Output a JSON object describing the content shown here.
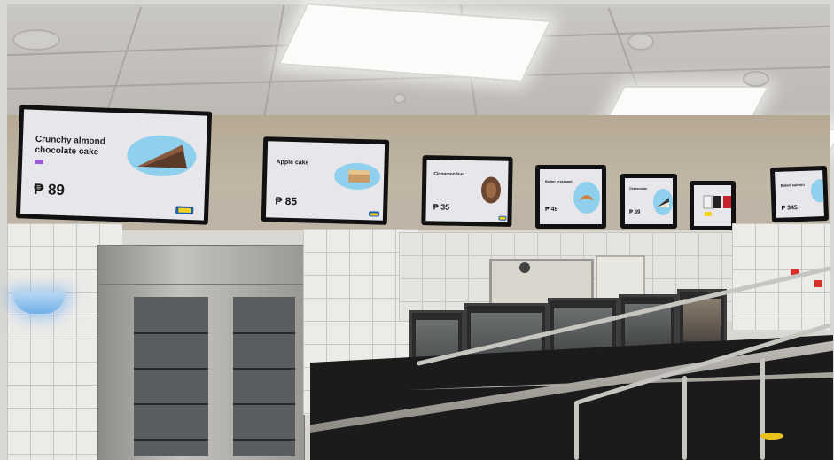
{
  "menu_screens": [
    {
      "title": "Crunchy almond chocolate cake",
      "price": "₱ 89",
      "food": "chocolate-cake-slice"
    },
    {
      "title": "Apple cake",
      "price": "₱ 85",
      "food": "apple-cake-slice"
    },
    {
      "title": "Cinnamon bun",
      "price": "₱ 35",
      "food": "cinnamon-bun"
    },
    {
      "title": "Butter croissant",
      "price": "₱ 49",
      "food": "croissant"
    },
    {
      "title": "Cheesecake",
      "price": "₱ 89",
      "food": "cheesecake-slice"
    },
    {
      "title": "",
      "price": "",
      "food": "drink-cups"
    },
    {
      "title": "Baked salmon",
      "price": "₱ 345",
      "food": "salmon-plate"
    }
  ],
  "colors": {
    "screen_bg": "#e7e6ea",
    "food_highlight": "#8fd0ee",
    "logo_blue": "#1f5fb0",
    "logo_yellow": "#f3d21f",
    "counter": "#1b1b1b",
    "wall_tile": "#ecebe8"
  }
}
